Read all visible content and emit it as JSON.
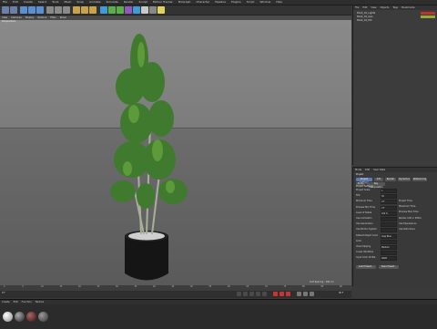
{
  "menubar": {
    "items": [
      "File",
      "Edit",
      "Create",
      "Select",
      "Tools",
      "Mesh",
      "Snap",
      "Animate",
      "Simulate",
      "Render",
      "Sculpt",
      "Motion Tracker",
      "MoGraph",
      "Character",
      "Pipeline",
      "Plugins",
      "Script",
      "Window",
      "Help"
    ]
  },
  "viewport": {
    "menu": [
      "View",
      "Cameras",
      "Display",
      "Options",
      "Filter",
      "Panel"
    ],
    "label": "Perspective",
    "grid_label": "Grid Spacing : 100 cm"
  },
  "object_manager": {
    "menu": [
      "File",
      "Edit",
      "View",
      "Objects",
      "Tags",
      "Bookmarks"
    ],
    "rows": [
      "Plant_10_Lights",
      "Plant_10_Geo",
      "Plant_10_Pot"
    ]
  },
  "attribute_manager": {
    "menu": [
      "Mode",
      "Edit",
      "User Data"
    ],
    "title": "Project",
    "tabs": [
      "Project Settings",
      "Info",
      "Render",
      "Dynamics",
      "Referencing",
      "To Do",
      "Key Interpolation"
    ],
    "section": "Project Settings",
    "fields": [
      {
        "label": "Project Scale",
        "value": "1"
      },
      {
        "label": "FPS",
        "value": "30"
      },
      {
        "label": "Minimum Time",
        "value": "0 F"
      },
      {
        "label": "Preview Min Time",
        "value": "0 F"
      },
      {
        "label": "Level of Detail",
        "value": "100 %"
      },
      {
        "label": "Use Animation",
        "value": ""
      },
      {
        "label": "Use Generators",
        "value": ""
      },
      {
        "label": "Use Motion System",
        "value": ""
      },
      {
        "label": "Default Object Color",
        "value": "Gray Blue"
      },
      {
        "label": "Color",
        "value": ""
      },
      {
        "label": "View Clipping",
        "value": "Medium"
      },
      {
        "label": "Linear Workflow",
        "value": ""
      },
      {
        "label": "Input Color Profile",
        "value": "sRGB"
      }
    ],
    "right_fields": [
      "Project Time",
      "Maximum Time",
      "Preview Max Time",
      "Render LOD in Editor",
      "Use Expressions",
      "Use Deformers"
    ],
    "buttons": [
      "Load Preset...",
      "Save Preset..."
    ]
  },
  "timeline": {
    "ticks": [
      "0",
      "5",
      "10",
      "15",
      "20",
      "25",
      "30",
      "35",
      "40",
      "45",
      "50",
      "55",
      "60",
      "65",
      "70",
      "75",
      "80",
      "85",
      "90"
    ],
    "frame": "0 F",
    "end": "90 F"
  },
  "material_manager": {
    "menu": [
      "Create",
      "Edit",
      "Function",
      "Texture"
    ],
    "count": 4
  },
  "colors": {
    "accent": "#5a7bb5",
    "bg": "#3a3a3a",
    "leaf": "#3f7a2e",
    "pot": "#151515"
  }
}
